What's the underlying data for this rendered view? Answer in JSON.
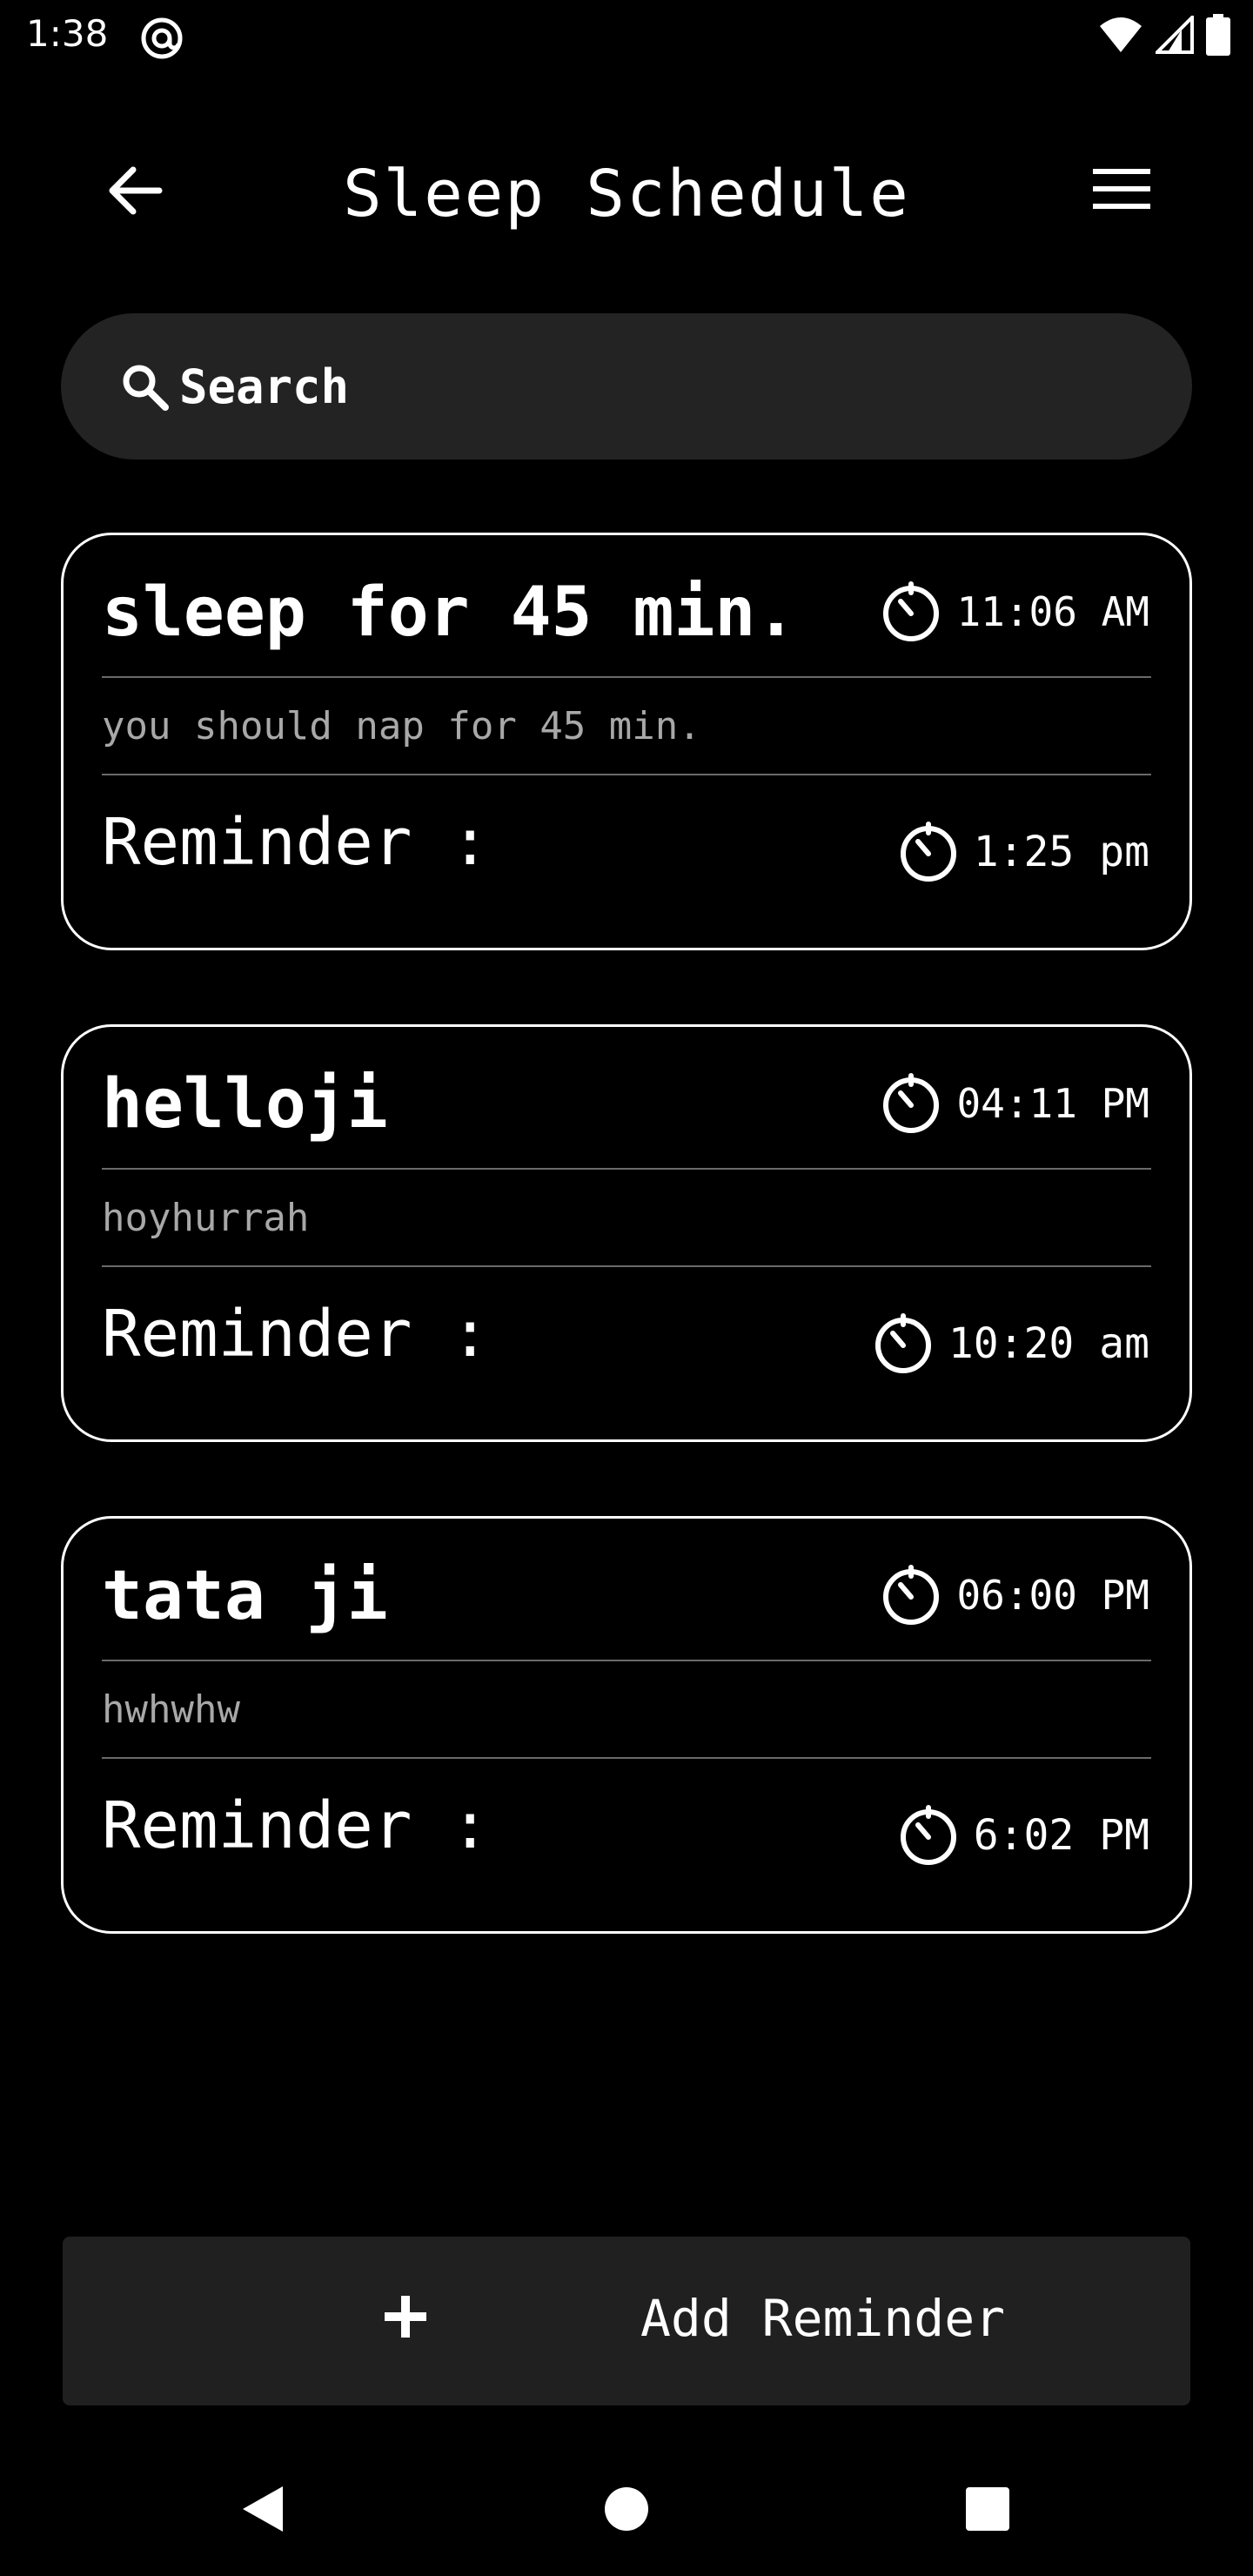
{
  "status_bar": {
    "time": "1:38",
    "app_icon": "at-sign-icon",
    "icons": [
      "wifi-icon",
      "signal-icon",
      "battery-icon"
    ]
  },
  "header": {
    "title": "Sleep Schedule",
    "back_icon": "arrow-back-icon",
    "menu_icon": "hamburger-menu-icon"
  },
  "search": {
    "placeholder": "Search",
    "icon": "search-icon"
  },
  "reminders": [
    {
      "title": "sleep for 45 min.",
      "time": "11:06 AM",
      "note": "you should nap for 45 min.",
      "reminder_label": "Reminder :",
      "reminder_time": "1:25 pm"
    },
    {
      "title": "helloji",
      "time": "04:11 PM",
      "note": "hoyhurrah",
      "reminder_label": "Reminder :",
      "reminder_time": "10:20 am"
    },
    {
      "title": "tata ji",
      "time": "06:00 PM",
      "note": "hwhwhw",
      "reminder_label": "Reminder :",
      "reminder_time": "6:02 PM"
    }
  ],
  "add_button": {
    "label": "Add Reminder",
    "icon": "plus-icon"
  },
  "nav": {
    "icons": [
      "nav-back-icon",
      "nav-home-icon",
      "nav-recents-icon"
    ]
  },
  "colors": {
    "background": "#000000",
    "surface": "#232323",
    "text": "#ffffff",
    "muted_text": "#a8a8a8",
    "divider": "#6a6a6a"
  }
}
